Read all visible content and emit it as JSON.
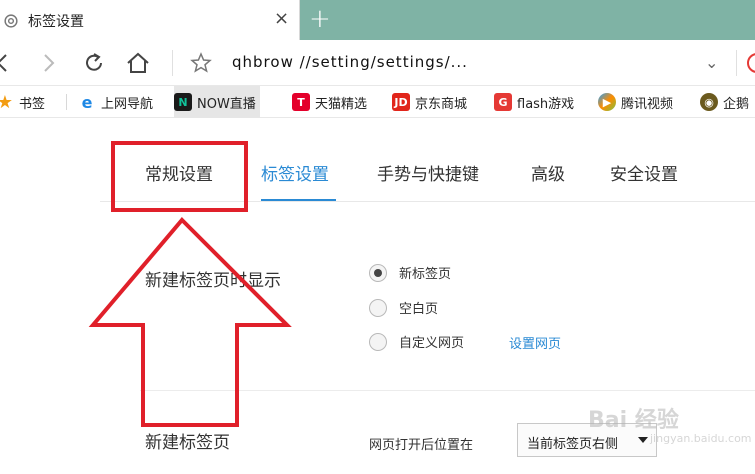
{
  "tab": {
    "title": "标签设置",
    "close_glyph": "×",
    "new_tab_glyph": "+"
  },
  "toolbar": {
    "address": "qhbrow      //setting/settings/...",
    "dropdown_glyph": "⌄"
  },
  "bookmarks": [
    {
      "label": "书签",
      "icon": "star-icon",
      "color": "#f39c12"
    },
    {
      "label": "上网导航",
      "icon": "ie-icon",
      "color": "#1e88e5"
    },
    {
      "label": "NOW直播",
      "icon": "now-icon",
      "color": "#11c39b"
    },
    {
      "label": "天猫精选",
      "icon": "tmall-icon",
      "color": "#e4002b"
    },
    {
      "label": "京东商城",
      "icon": "jd-icon",
      "color": "#e1251b"
    },
    {
      "label": "flash游戏",
      "icon": "flash-game-icon",
      "color": "#e53935"
    },
    {
      "label": "腾讯视频",
      "icon": "tencent-video-icon",
      "color": "#20a0ff"
    },
    {
      "label": "企鹅",
      "icon": "penguin-icon",
      "color": "#333333"
    }
  ],
  "nav": {
    "tabs": [
      "常规设置",
      "标签设置",
      "手势与快捷键",
      "高级",
      "安全设置"
    ],
    "active_index": 1
  },
  "settings": {
    "new_tab_label": "新建标签页时显示",
    "options": [
      "新标签页",
      "空白页",
      "自定义网页"
    ],
    "selected_option": 0,
    "custom_link": "设置网页",
    "section2_label": "新建标签页",
    "position_label": "网页打开后位置在",
    "position_value": "当前标签页右侧"
  },
  "watermark": {
    "text": "Bai 经验",
    "sub": "jingyan.baidu.com"
  },
  "colors": {
    "accent": "#2a8ad4",
    "annotation": "#e0202a",
    "tabstrip": "#7fb3a5"
  }
}
